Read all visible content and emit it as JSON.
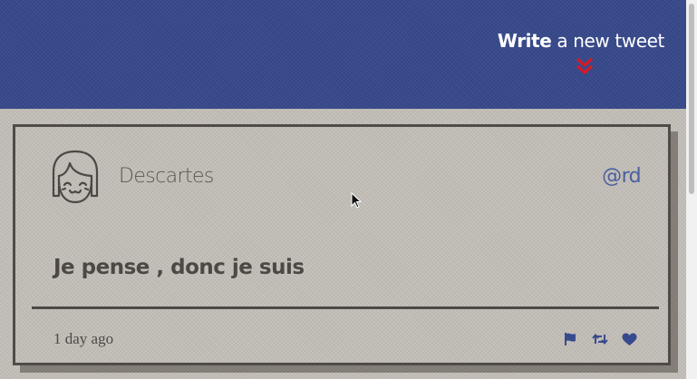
{
  "header": {
    "write_strong": "Write",
    "write_rest": " a new tweet"
  },
  "tweet": {
    "author_name": "Descartes",
    "handle": "@rd",
    "text": "Je pense , donc je suis",
    "timestamp": "1 day ago"
  },
  "actions": [
    {
      "icon": "flag-icon"
    },
    {
      "icon": "retweet-icon"
    },
    {
      "icon": "heart-icon"
    }
  ],
  "colors": {
    "header_bg": "#384a8e",
    "accent_red": "#d31b27",
    "accent_blue": "#4a5fa0",
    "page_bg": "#c4c0b9",
    "text_dark": "#4d4843"
  }
}
